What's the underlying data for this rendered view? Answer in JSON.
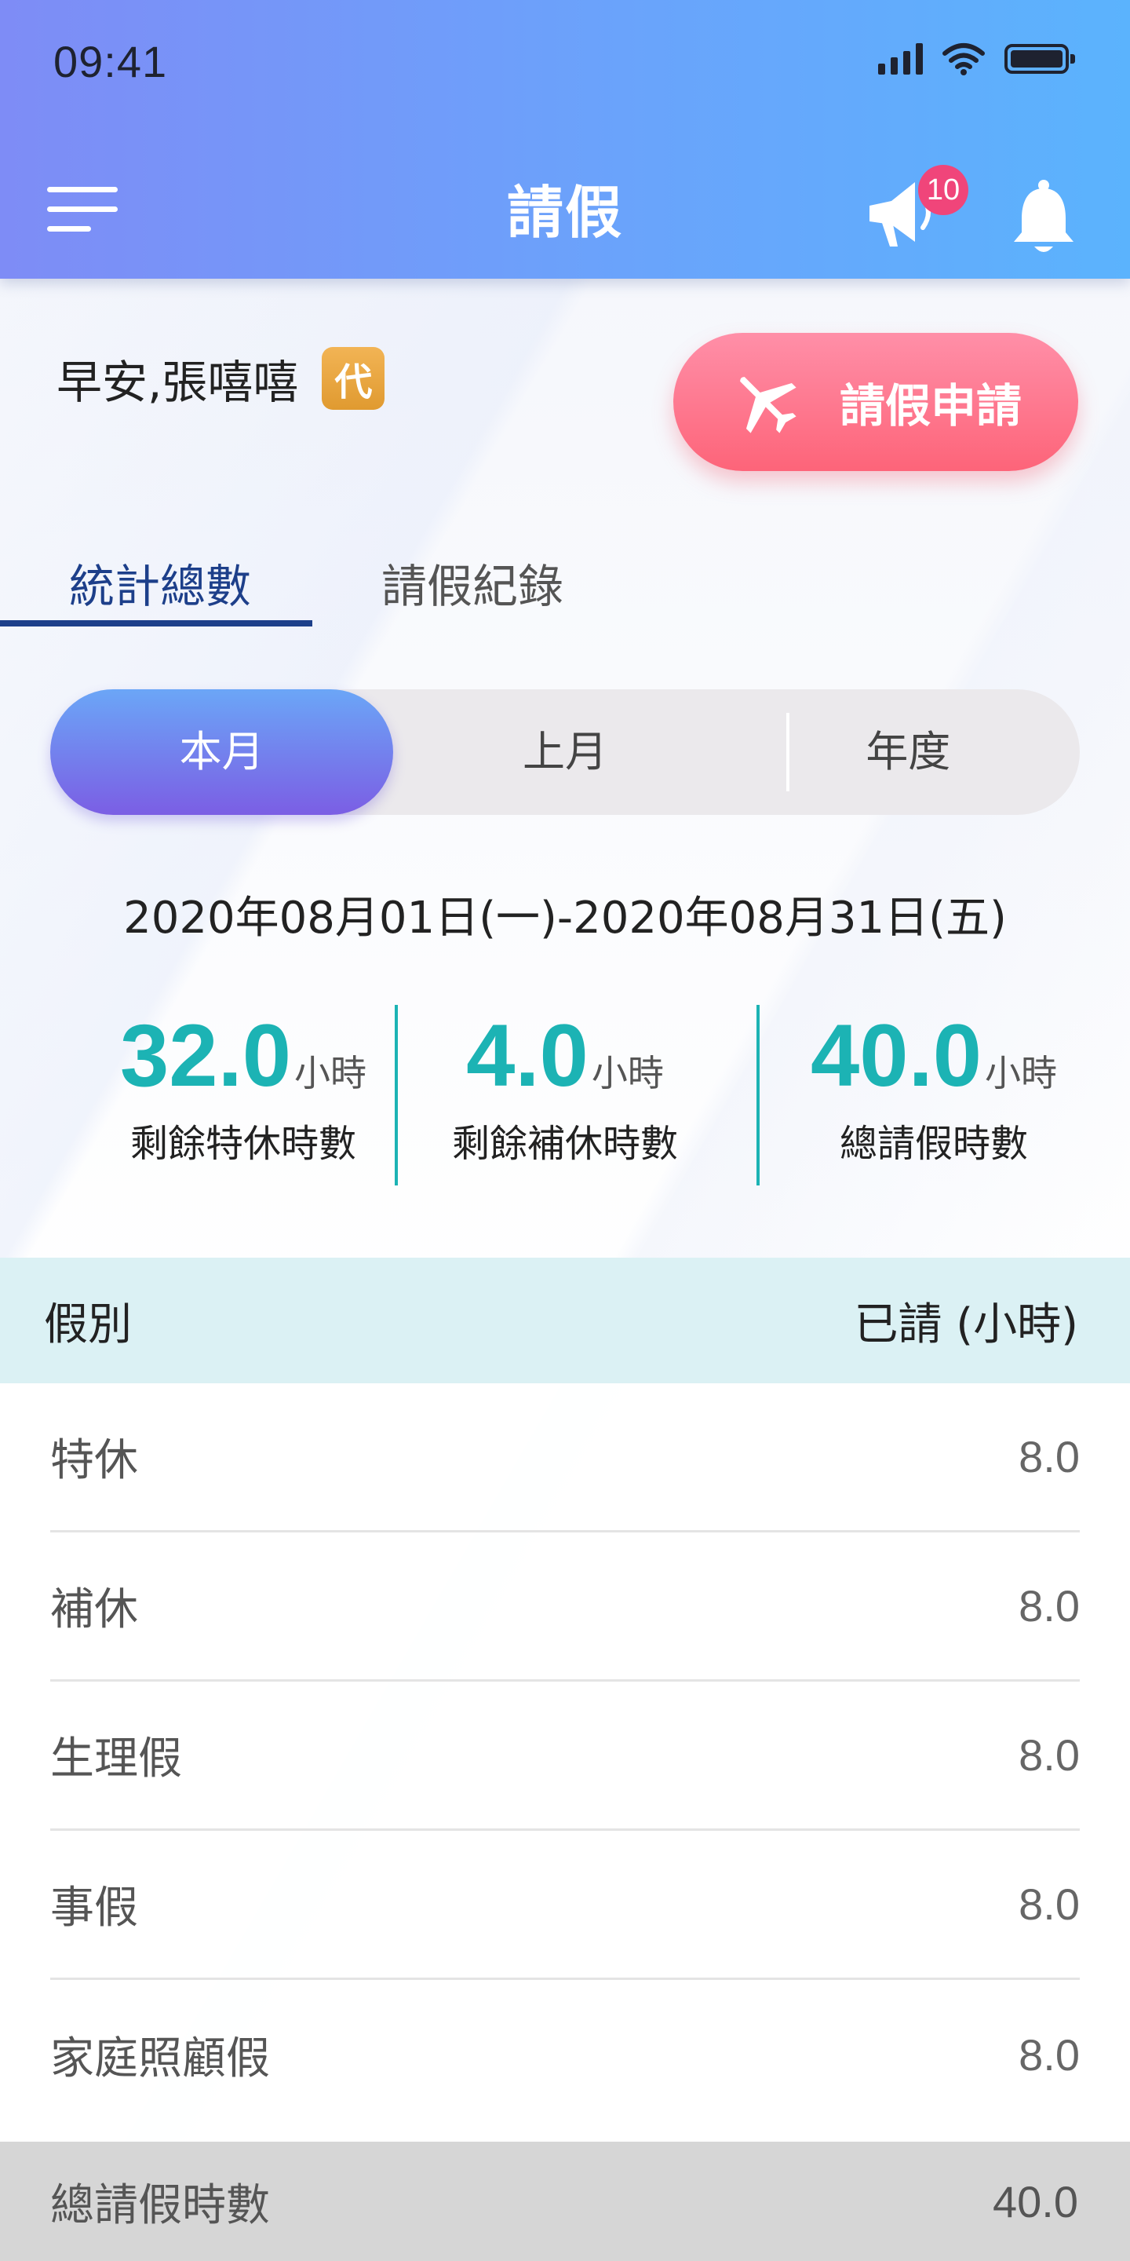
{
  "status_bar": {
    "time": "09:41"
  },
  "header": {
    "title": "請假",
    "announcement_count": "10"
  },
  "greeting": {
    "text": "早安,張嘻嘻",
    "proxy_badge": "代"
  },
  "apply_button": {
    "label": "請假申請"
  },
  "tabs": [
    {
      "label": "統計總數",
      "active": true
    },
    {
      "label": "請假紀錄",
      "active": false
    }
  ],
  "period_selector": {
    "options": [
      "本月",
      "上月",
      "年度"
    ],
    "selected": "本月"
  },
  "date_range": "2020年08月01日(一)-2020年08月31日(五)",
  "stats": [
    {
      "value": "32.0",
      "unit": "小時",
      "label": "剩餘特休時數"
    },
    {
      "value": "4.0",
      "unit": "小時",
      "label": "剩餘補休時數"
    },
    {
      "value": "40.0",
      "unit": "小時",
      "label": "總請假時數"
    }
  ],
  "table": {
    "col_type": "假別",
    "col_hours": "已請 (小時)",
    "rows": [
      {
        "type": "特休",
        "hours": "8.0"
      },
      {
        "type": "補休",
        "hours": "8.0"
      },
      {
        "type": "生理假",
        "hours": "8.0"
      },
      {
        "type": "事假",
        "hours": "8.0"
      },
      {
        "type": "家庭照顧假",
        "hours": "8.0"
      }
    ],
    "total_label": "總請假時數",
    "total_value": "40.0"
  },
  "colors": {
    "accent_teal": "#1cb3b4",
    "tab_active": "#1d3f8a",
    "apply_pink": "#fd6479",
    "badge_red": "#f0457a",
    "proxy_orange": "#e09a30"
  },
  "icons": [
    "menu-icon",
    "megaphone-icon",
    "bell-icon",
    "airplane-icon",
    "signal-icon",
    "wifi-icon",
    "battery-icon"
  ]
}
